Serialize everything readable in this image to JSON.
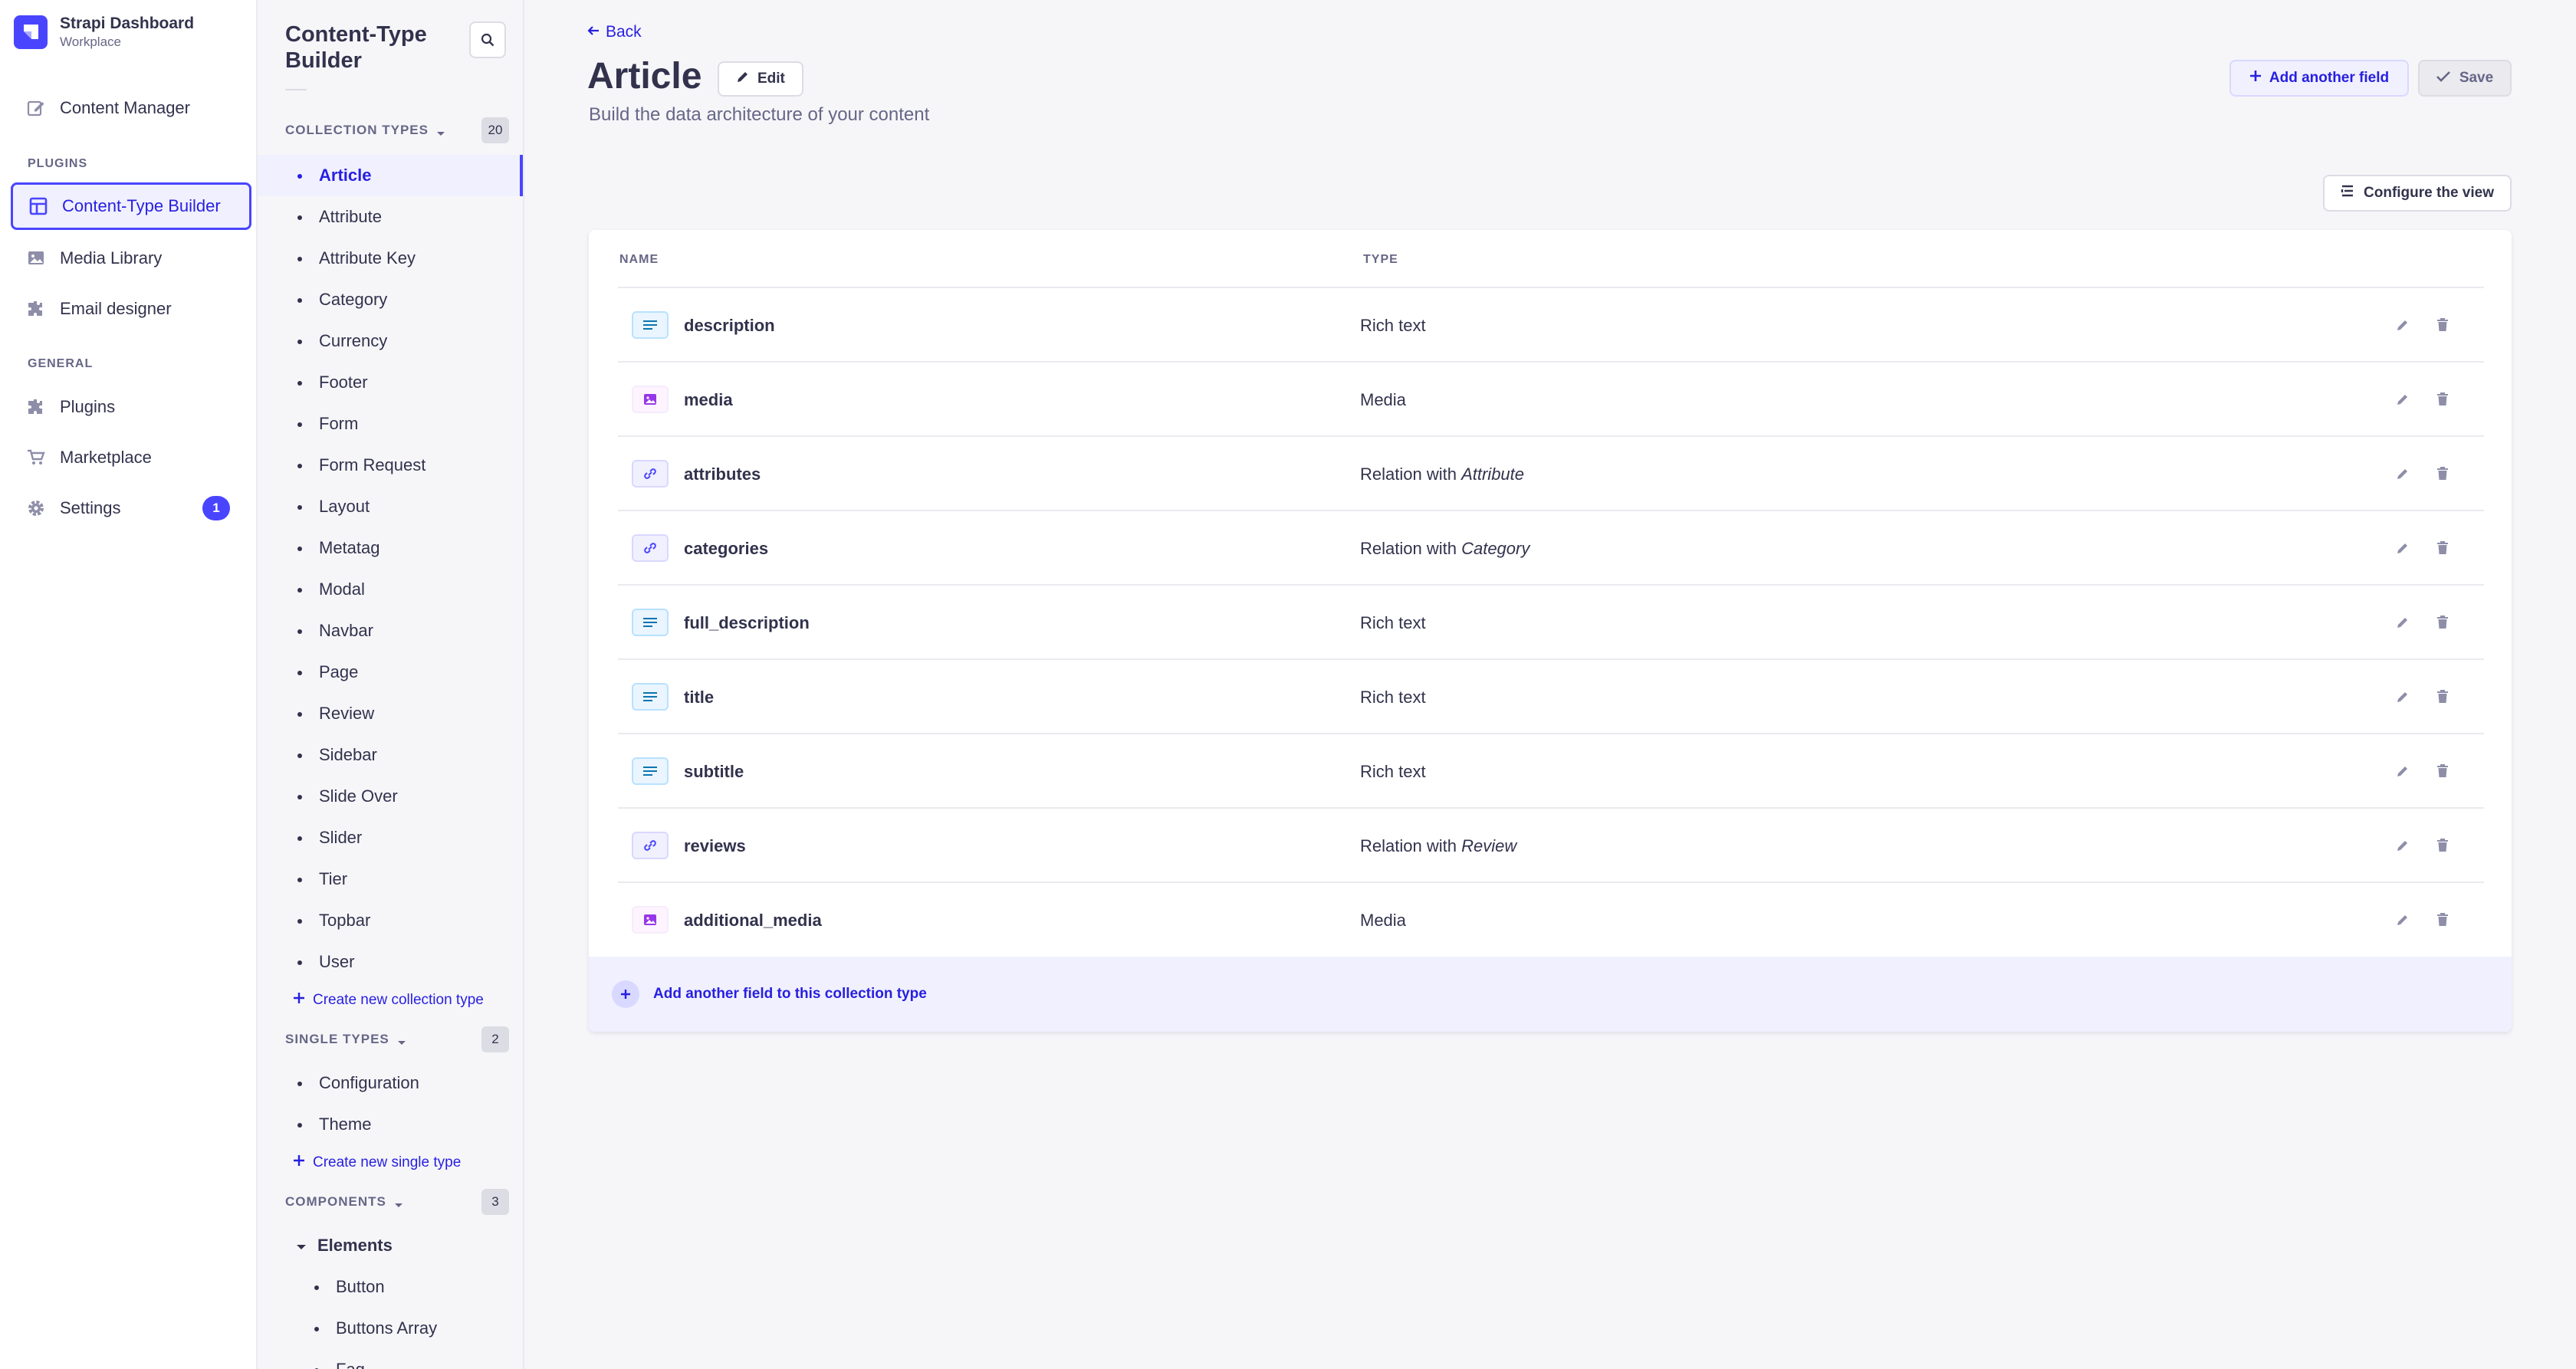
{
  "app": {
    "title": "Strapi Dashboard",
    "workspace": "Workplace"
  },
  "mainnav": {
    "items": [
      {
        "label": "Content Manager",
        "icon": "pencil-square-icon"
      },
      {
        "label": "Content-Type Builder",
        "icon": "layout-icon",
        "active": true
      },
      {
        "label": "Media Library",
        "icon": "image-icon"
      },
      {
        "label": "Email designer",
        "icon": "puzzle-icon"
      },
      {
        "label": "Plugins",
        "icon": "puzzle-icon"
      },
      {
        "label": "Marketplace",
        "icon": "cart-icon"
      },
      {
        "label": "Settings",
        "icon": "gear-icon",
        "badge": "1"
      }
    ],
    "section_plugins": "PLUGINS",
    "section_general": "GENERAL"
  },
  "subnav": {
    "title": "Content-Type Builder",
    "collection_types": {
      "label": "COLLECTION TYPES",
      "count": "20",
      "items": [
        "Article",
        "Attribute",
        "Attribute Key",
        "Category",
        "Currency",
        "Footer",
        "Form",
        "Form Request",
        "Layout",
        "Metatag",
        "Modal",
        "Navbar",
        "Page",
        "Review",
        "Sidebar",
        "Slide Over",
        "Slider",
        "Tier",
        "Topbar",
        "User"
      ],
      "create_label": "Create new collection type"
    },
    "single_types": {
      "label": "SINGLE TYPES",
      "count": "2",
      "items": [
        "Configuration",
        "Theme"
      ],
      "create_label": "Create new single type"
    },
    "components": {
      "label": "COMPONENTS",
      "count": "3",
      "group": "Elements",
      "items": [
        "Button",
        "Buttons Array",
        "Faq"
      ]
    }
  },
  "header": {
    "back_label": "Back",
    "title": "Article",
    "edit_label": "Edit",
    "subtitle": "Build the data architecture of your content",
    "add_field_label": "Add another field",
    "save_label": "Save",
    "configure_label": "Configure the view"
  },
  "table": {
    "col_name": "NAME",
    "col_type": "TYPE",
    "rows": [
      {
        "name": "description",
        "type": "Rich text",
        "kind": "text"
      },
      {
        "name": "media",
        "type": "Media",
        "kind": "media"
      },
      {
        "name": "attributes",
        "type": "Relation with ",
        "target": "Attribute",
        "kind": "relation"
      },
      {
        "name": "categories",
        "type": "Relation with ",
        "target": "Category",
        "kind": "relation"
      },
      {
        "name": "full_description",
        "type": "Rich text",
        "kind": "text"
      },
      {
        "name": "title",
        "type": "Rich text",
        "kind": "text"
      },
      {
        "name": "subtitle",
        "type": "Rich text",
        "kind": "text"
      },
      {
        "name": "reviews",
        "type": "Relation with ",
        "target": "Review",
        "kind": "relation"
      },
      {
        "name": "additional_media",
        "type": "Media",
        "kind": "media"
      }
    ],
    "add_row_label": "Add another field to this collection type"
  },
  "colors": {
    "primary": "#4945ff",
    "primary_dark": "#271fe0",
    "primary_light": "#f0f0ff",
    "neutral_bg": "#f6f6f9"
  }
}
